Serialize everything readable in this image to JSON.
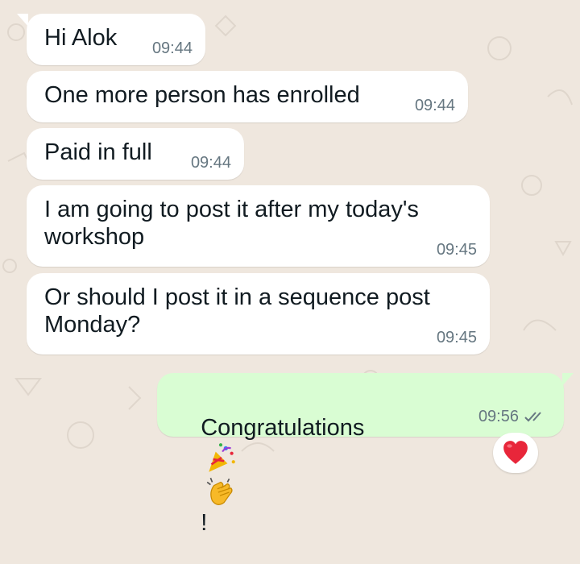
{
  "messages": [
    {
      "text": "Hi Alok",
      "time": "09:44",
      "direction": "incoming"
    },
    {
      "text": "One more person has enrolled",
      "time": "09:44",
      "direction": "incoming"
    },
    {
      "text": "Paid in full",
      "time": "09:44",
      "direction": "incoming"
    },
    {
      "text": "I am going to post it after my today's\nworkshop",
      "time": "09:45",
      "direction": "incoming"
    },
    {
      "text": "Or should I post it in a sequence post\nMonday?",
      "time": "09:45",
      "direction": "incoming"
    },
    {
      "text": "Congratulations",
      "suffix": "!",
      "emojis": [
        "party-popper-icon",
        "clapping-hands-icon"
      ],
      "time": "09:56",
      "direction": "outgoing",
      "status": "read-double-check-icon"
    }
  ],
  "reaction": {
    "icon": "red-heart-icon"
  },
  "colors": {
    "background": "#efe7de",
    "incoming_bubble": "#ffffff",
    "outgoing_bubble": "#d9fdd3",
    "timestamp": "#667781",
    "read_ticks": "#667781",
    "heart": "#e8263a"
  }
}
